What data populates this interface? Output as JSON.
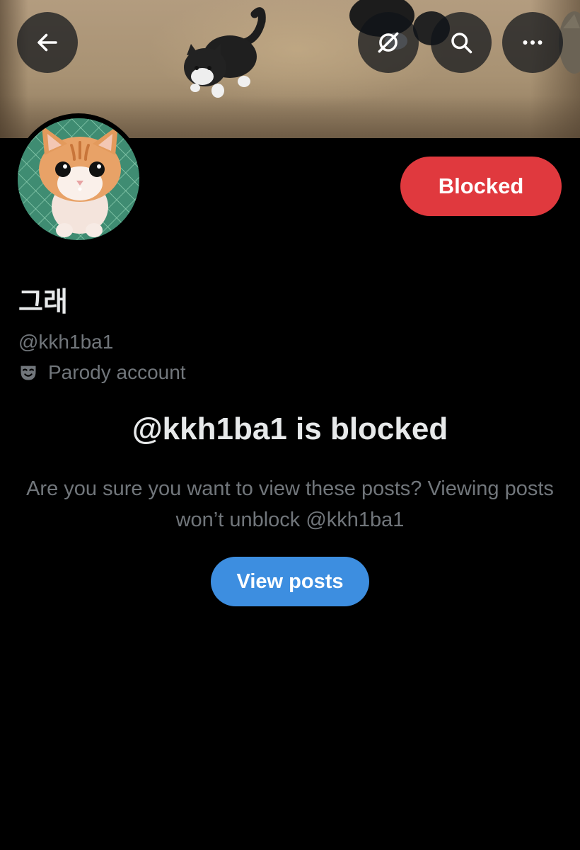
{
  "header": {
    "back_icon": "arrow-left-icon",
    "grok_icon": "slashed-circle-icon",
    "search_icon": "search-icon",
    "more_icon": "more-horizontal-icon"
  },
  "profile": {
    "display_name": "그래",
    "handle": "@kkh1ba1",
    "label_icon": "parody-mask-icon",
    "label_text": "Parody account",
    "relationship_button_label": "Blocked"
  },
  "blocked_notice": {
    "title": "@kkh1ba1 is blocked",
    "description": "Are you sure you want to view these posts? Viewing posts won’t unblock @kkh1ba1",
    "view_button_label": "View posts"
  },
  "colors": {
    "background": "#000000",
    "primary_text": "#e7e9ea",
    "secondary_text": "#71767b",
    "blocked_red": "#e0393e",
    "accent_blue": "#3d8ee0"
  }
}
